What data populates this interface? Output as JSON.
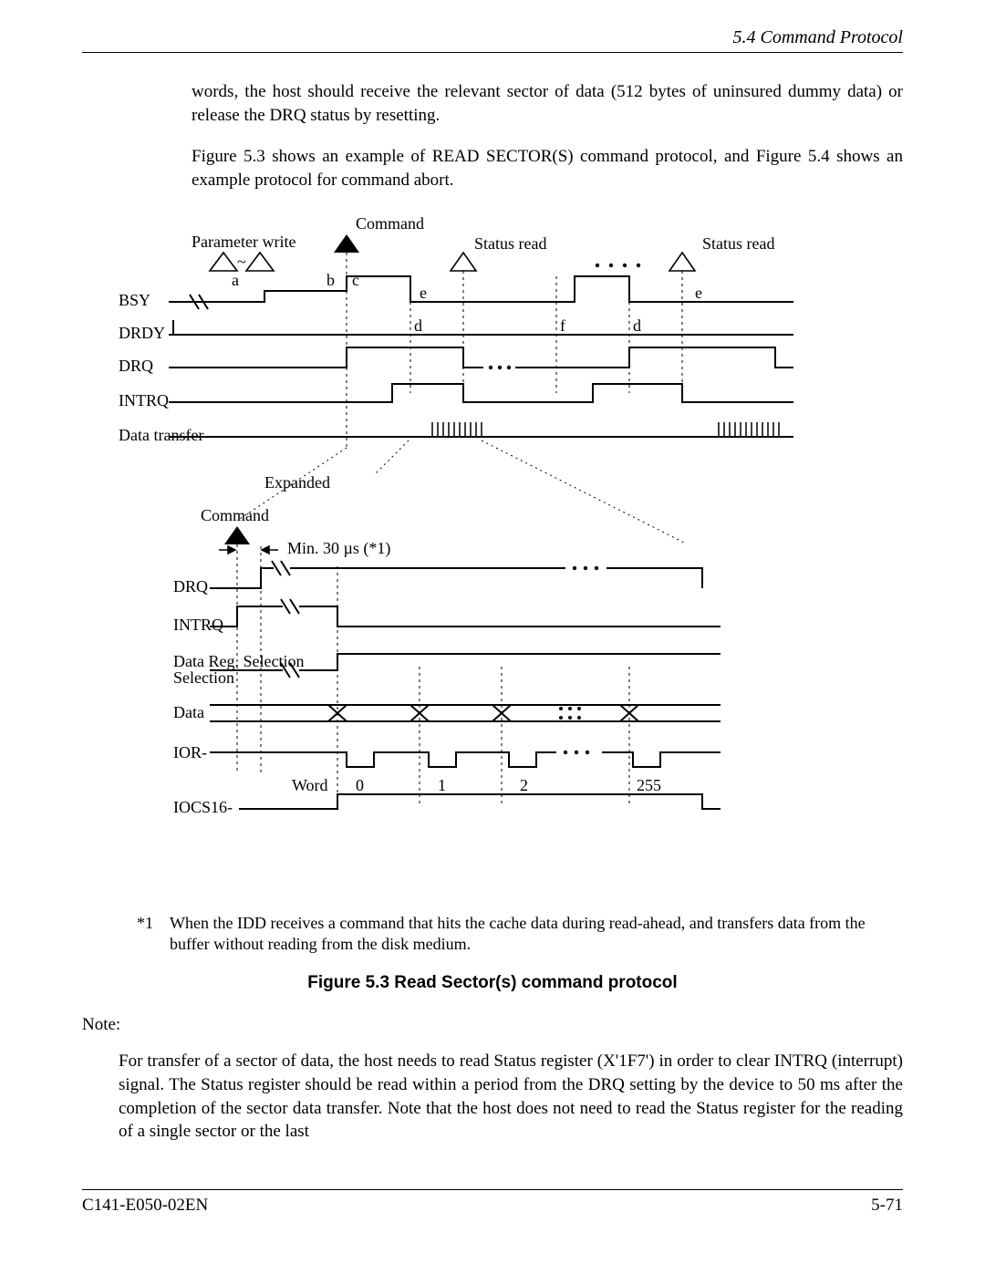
{
  "header": {
    "section": "5.4  Command Protocol"
  },
  "body": {
    "p1": "words, the host should receive the relevant sector of data (512 bytes of uninsured dummy data) or release the DRQ status by resetting.",
    "p2": "Figure 5.3 shows an example of READ SECTOR(S) command protocol, and Figure 5.4 shows an example protocol for command abort."
  },
  "diagram": {
    "upper": {
      "title_cmd": "Command",
      "param_write": "Parameter write",
      "status_read": "Status read",
      "signals": [
        "BSY",
        "DRDY",
        "DRQ",
        "INTRQ",
        "Data transfer"
      ],
      "markers": {
        "a": "a",
        "b": "b",
        "c": "c",
        "d": "d",
        "e": "e",
        "f": "f"
      }
    },
    "expanded_label": "Expanded",
    "lower": {
      "cmd": "Command",
      "min_time": "Min. 30 µs (*1)",
      "signals": [
        "DRQ",
        "INTRQ",
        "Data Reg. Selection",
        "Data",
        "IOR-",
        "IOCS16-"
      ],
      "word_label": "Word",
      "words": [
        "0",
        "1",
        "2",
        "255"
      ]
    }
  },
  "footnote": {
    "mark": "*1",
    "text": "When the IDD receives a command that hits the cache data during read-ahead, and transfers data from the buffer without reading from the disk medium."
  },
  "caption": "Figure 5.3  Read Sector(s) command protocol",
  "note": {
    "label": "Note:",
    "text": "For transfer of a sector of data, the host needs to read Status register (X'1F7') in order to clear INTRQ (interrupt) signal. The Status register should be read within a period from the DRQ setting by the device to 50 ms after the completion of the sector data transfer.  Note that the host does not need to read the Status register for the reading of a single sector or the last"
  },
  "footer": {
    "doc": "C141-E050-02EN",
    "page": "5-71"
  }
}
